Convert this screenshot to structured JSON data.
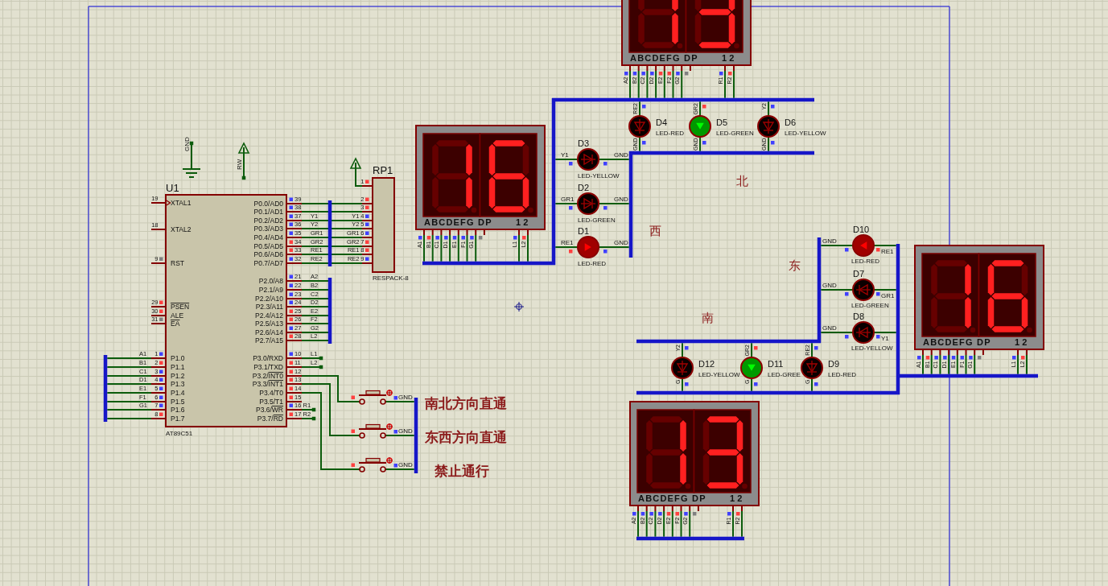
{
  "north": {
    "label": "北",
    "display": {
      "digits": [
        {
          "b": true,
          "c": true,
          "d": false,
          "e": false,
          "f": false,
          "g": false,
          "dp": false
        },
        {
          "b": true,
          "c": true,
          "d": true,
          "e": false,
          "f": false,
          "g": true,
          "dp": false
        }
      ],
      "segment_labels": "ABCDEFG DP",
      "digit_labels": "1 2",
      "pins": [
        {
          "net": "A2",
          "color": "#4040ff"
        },
        {
          "net": "B2",
          "color": "#4040ff"
        },
        {
          "net": "C2",
          "color": "#4040ff"
        },
        {
          "net": "D2",
          "color": "#4040ff"
        },
        {
          "net": "E2",
          "color": "#ff4040"
        },
        {
          "net": "F2",
          "color": "#ff4040"
        },
        {
          "net": "G2",
          "color": "#4040ff"
        },
        {
          "color": "#808080"
        },
        {
          "net": "R1",
          "color": "#4040ff"
        },
        {
          "net": "R2",
          "color": "#ff4040"
        }
      ]
    },
    "leds": [
      {
        "ref": "D4",
        "part": "LED-RED",
        "on": false,
        "anode": {
          "net": "RE2",
          "color": "#4040ff"
        },
        "cathode": {
          "net": "GND",
          "color": "#4040ff"
        }
      },
      {
        "ref": "D5",
        "part": "LED-GREEN",
        "on": true,
        "color": "#009900",
        "anode": {
          "net": "GR2",
          "color": "#ff4040"
        },
        "cathode": {
          "net": "GND",
          "color": "#4040ff"
        }
      },
      {
        "ref": "D6",
        "part": "LED-YELLOW",
        "on": false,
        "anode": {
          "net": "Y2",
          "color": "#4040ff"
        },
        "cathode": {
          "net": "GND",
          "color": "#4040ff"
        }
      }
    ]
  },
  "terminals": [
    {
      "kind": "ground",
      "label": "GND"
    },
    {
      "kind": "power",
      "label": "RW"
    },
    {
      "kind": "power"
    }
  ],
  "mcu": {
    "ref": "U1",
    "part": "AT89C51",
    "left_pins": [
      {
        "number": "19",
        "name": "XTAL1",
        "clock": true
      },
      {
        "number": "18",
        "name": "XTAL2",
        "clock": false
      },
      {
        "number": "9",
        "name": "RST",
        "clock": false,
        "color": "#808080"
      },
      {
        "number": "29",
        "bar": "PSEN",
        "clock": false,
        "color": "#ff4040"
      },
      {
        "number": "30",
        "name": "ALE",
        "clock": false,
        "color": "#ff4040"
      },
      {
        "number": "31",
        "bar": "EA",
        "clock": false,
        "color": "#808080"
      },
      {
        "number": "1",
        "name": "P1.0",
        "net": "A1",
        "clock": false,
        "color": "#4040ff"
      },
      {
        "number": "2",
        "name": "P1.1",
        "net": "B1",
        "clock": false,
        "color": "#ff4040"
      },
      {
        "number": "3",
        "name": "P1.2",
        "net": "C1",
        "clock": false,
        "color": "#4040ff"
      },
      {
        "number": "4",
        "name": "P1.3",
        "net": "D1",
        "clock": false,
        "color": "#4040ff"
      },
      {
        "number": "5",
        "name": "P1.4",
        "net": "E1",
        "clock": false,
        "color": "#4040ff"
      },
      {
        "number": "6",
        "name": "P1.5",
        "net": "F1",
        "clock": false,
        "color": "#4040ff"
      },
      {
        "number": "7",
        "name": "P1.6",
        "net": "G1",
        "clock": false,
        "color": "#4040ff"
      },
      {
        "number": "8",
        "name": "P1.7",
        "clock": false,
        "color": "#ff4040"
      }
    ],
    "right_pins": [
      {
        "number": "39",
        "name": "P0.0/AD0",
        "color": "#4040ff"
      },
      {
        "number": "38",
        "name": "P0.1/AD1",
        "color": "#4040ff"
      },
      {
        "number": "37",
        "name": "P0.2/AD2",
        "net": "Y1",
        "color": "#4040ff"
      },
      {
        "number": "36",
        "name": "P0.3/AD3",
        "net": "Y2",
        "color": "#4040ff"
      },
      {
        "number": "35",
        "name": "P0.4/AD4",
        "net": "GR1",
        "color": "#4040ff"
      },
      {
        "number": "34",
        "name": "P0.5/AD5",
        "net": "GR2",
        "color": "#ff4040"
      },
      {
        "number": "33",
        "name": "P0.6/AD6",
        "net": "RE1",
        "color": "#ff4040"
      },
      {
        "number": "32",
        "name": "P0.7/AD7",
        "net": "RE2",
        "color": "#4040ff"
      },
      {
        "number": "21",
        "name": "P2.0/A8",
        "net": "A2",
        "color": "#4040ff"
      },
      {
        "number": "22",
        "name": "P2.1/A9",
        "net": "B2",
        "color": "#4040ff"
      },
      {
        "number": "23",
        "name": "P2.2/A10",
        "net": "C2",
        "color": "#4040ff"
      },
      {
        "number": "24",
        "name": "P2.3/A11",
        "net": "D2",
        "color": "#4040ff"
      },
      {
        "number": "25",
        "name": "P2.4/A12",
        "net": "E2",
        "color": "#ff4040"
      },
      {
        "number": "26",
        "name": "P2.5/A13",
        "net": "F2",
        "color": "#ff4040"
      },
      {
        "number": "27",
        "name": "P2.6/A14",
        "net": "G2",
        "color": "#4040ff"
      },
      {
        "number": "28",
        "name": "P2.7/A15",
        "net": "L2",
        "color": "#ff4040"
      },
      {
        "number": "10",
        "name": "P3.0/RXD",
        "net": "L1",
        "color": "#4040ff"
      },
      {
        "number": "11",
        "name": "P3.1/TXD",
        "net": "L2",
        "color": "#ff4040"
      },
      {
        "number": "12",
        "name": "P3.2/",
        "bar": "INT0",
        "color": "#ff4040"
      },
      {
        "number": "13",
        "name": "P3.3/",
        "bar": "INT1",
        "color": "#ff4040"
      },
      {
        "number": "14",
        "name": "P3.4/T0",
        "color": "#ff4040"
      },
      {
        "number": "15",
        "name": "P3.5/T1",
        "color": "#ff4040"
      },
      {
        "number": "16",
        "name": "P3.6/",
        "bar": "WR",
        "net": "R1",
        "color": "#4040ff"
      },
      {
        "number": "17",
        "name": "P3.7/",
        "bar": "RD",
        "net": "R2",
        "color": "#ff4040"
      }
    ]
  },
  "resistor_pack": {
    "ref": "RP1",
    "part": "RESPACK-8",
    "pins": [
      {
        "number": "1",
        "color": "#ff4040"
      },
      {
        "number": "2",
        "color": "#ff4040"
      },
      {
        "number": "3",
        "color": "#ff4040"
      },
      {
        "number": "4",
        "net": "Y1",
        "color": "#4040ff"
      },
      {
        "number": "5",
        "net": "Y2",
        "color": "#4040ff"
      },
      {
        "number": "6",
        "net": "GR1",
        "color": "#4040ff"
      },
      {
        "number": "7",
        "net": "GR2",
        "color": "#ff4040"
      },
      {
        "number": "8",
        "net": "RE1",
        "color": "#ff4040"
      },
      {
        "number": "9",
        "net": "RE2",
        "color": "#4040ff"
      }
    ]
  },
  "west": {
    "label": "西",
    "display": {
      "digits": [
        {
          "a": false,
          "b": true,
          "c": true,
          "d": false,
          "e": false,
          "f": false,
          "g": false,
          "dp": false
        },
        {
          "a": true,
          "b": false,
          "c": true,
          "d": true,
          "e": true,
          "f": true,
          "g": true,
          "dp": false
        }
      ],
      "segment_labels": "ABCDEFG DP",
      "digit_labels": "1 2",
      "pins": [
        {
          "net": "A1",
          "color": "#4040ff"
        },
        {
          "net": "B1",
          "color": "#ff4040"
        },
        {
          "net": "C1",
          "color": "#4040ff"
        },
        {
          "net": "D1",
          "color": "#4040ff"
        },
        {
          "net": "E1",
          "color": "#4040ff"
        },
        {
          "net": "F1",
          "color": "#4040ff"
        },
        {
          "net": "G1",
          "color": "#4040ff"
        },
        {
          "color": "#808080"
        },
        {
          "net": "L1",
          "color": "#4040ff"
        },
        {
          "net": "L2",
          "color": "#ff4040"
        }
      ]
    },
    "leds": [
      {
        "ref": "D3",
        "part": "LED-YELLOW",
        "on": false,
        "anode": {
          "net": "Y1",
          "color": "#4040ff"
        },
        "cathode": {
          "net": "GND",
          "color": "#4040ff"
        }
      },
      {
        "ref": "D2",
        "part": "LED-GREEN",
        "on": false,
        "anode": {
          "net": "GR1",
          "color": "#4040ff"
        },
        "cathode": {
          "net": "GND",
          "color": "#4040ff"
        }
      },
      {
        "ref": "D1",
        "part": "LED-RED",
        "on": true,
        "color": "#a00000",
        "anode": {
          "net": "RE1",
          "color": "#ff4040"
        },
        "cathode": {
          "net": "GND",
          "color": "#4040ff"
        }
      }
    ]
  },
  "east": {
    "label": "东",
    "display": {
      "digits": [
        {
          "a": false,
          "b": true,
          "c": true,
          "d": false,
          "e": false,
          "f": false,
          "g": false,
          "dp": false
        },
        {
          "a": true,
          "b": false,
          "c": true,
          "d": true,
          "e": true,
          "f": true,
          "g": true,
          "dp": false
        }
      ],
      "segment_labels": "ABCDEFG DP",
      "digit_labels": "1 2",
      "pins": [
        {
          "net": "A1",
          "color": "#4040ff"
        },
        {
          "net": "B1",
          "color": "#ff4040"
        },
        {
          "net": "C1",
          "color": "#4040ff"
        },
        {
          "net": "D1",
          "color": "#4040ff"
        },
        {
          "net": "E1",
          "color": "#4040ff"
        },
        {
          "net": "F1",
          "color": "#4040ff"
        },
        {
          "net": "G1",
          "color": "#4040ff"
        },
        {
          "color": "#808080"
        },
        {
          "net": "L1",
          "color": "#4040ff"
        },
        {
          "net": "L2",
          "color": "#ff4040"
        }
      ]
    },
    "leds": [
      {
        "ref": "D10",
        "part": "LED-RED",
        "on": true,
        "color": "#a00000",
        "anode": {
          "net": "RE1",
          "color": "#ff4040"
        },
        "cathode": {
          "net": "GND",
          "color": "#4040ff"
        }
      },
      {
        "ref": "D7",
        "part": "LED-GREEN",
        "on": false,
        "anode": {
          "net": "GR1",
          "color": "#4040ff"
        },
        "cathode": {
          "net": "GND",
          "color": "#4040ff"
        }
      },
      {
        "ref": "D8",
        "part": "LED-YELLOW",
        "on": false,
        "anode": {
          "net": "Y1",
          "color": "#4040ff"
        },
        "cathode": {
          "net": "GND",
          "color": "#4040ff"
        }
      }
    ]
  },
  "south": {
    "label": "南",
    "display": {
      "digits": [
        {
          "a": false,
          "b": true,
          "c": true,
          "d": false,
          "e": false,
          "f": false,
          "g": false,
          "dp": false
        },
        {
          "a": true,
          "b": true,
          "c": true,
          "d": true,
          "e": false,
          "f": false,
          "g": true,
          "dp": false
        }
      ],
      "segment_labels": "ABCDEFG DP",
      "digit_labels": "1 2",
      "pins": [
        {
          "net": "A2",
          "color": "#4040ff"
        },
        {
          "net": "B2",
          "color": "#4040ff"
        },
        {
          "net": "C2",
          "color": "#4040ff"
        },
        {
          "net": "D2",
          "color": "#4040ff"
        },
        {
          "net": "E2",
          "color": "#ff4040"
        },
        {
          "net": "F2",
          "color": "#ff4040"
        },
        {
          "net": "G2",
          "color": "#4040ff"
        },
        {
          "color": "#808080"
        },
        {
          "net": "R1",
          "color": "#4040ff"
        },
        {
          "net": "R2",
          "color": "#ff4040"
        }
      ]
    },
    "leds": [
      {
        "ref": "D12",
        "part": "LED-YELLOW",
        "on": false,
        "anode": {
          "net": "Y2",
          "color": "#4040ff"
        },
        "cathode": {
          "net": "G",
          "color": "#4040ff"
        }
      },
      {
        "ref": "D11",
        "part": "LED-GREE",
        "on": true,
        "color": "#009900",
        "anode": {
          "net": "GR2",
          "color": "#ff4040"
        },
        "cathode": {
          "net": "G",
          "color": "#4040ff"
        }
      },
      {
        "ref": "D9",
        "part": "LED-RED",
        "on": false,
        "anode": {
          "net": "RE2",
          "color": "#4040ff"
        },
        "cathode": {
          "net": "G",
          "color": "#4040ff"
        }
      }
    ]
  },
  "buttons": [
    {
      "caption": "南北方向直通",
      "contact": {
        "color": "#ff4040"
      },
      "common": {
        "net": "GND",
        "color": "#4040ff"
      }
    },
    {
      "caption": "东西方向直通",
      "contact": {
        "color": "#ff4040"
      },
      "common": {
        "net": "GND",
        "color": "#4040ff"
      }
    },
    {
      "caption": "禁止通行",
      "contact": {
        "color": "#ff4040"
      },
      "common": {
        "net": "GND",
        "color": "#4040ff"
      }
    }
  ]
}
